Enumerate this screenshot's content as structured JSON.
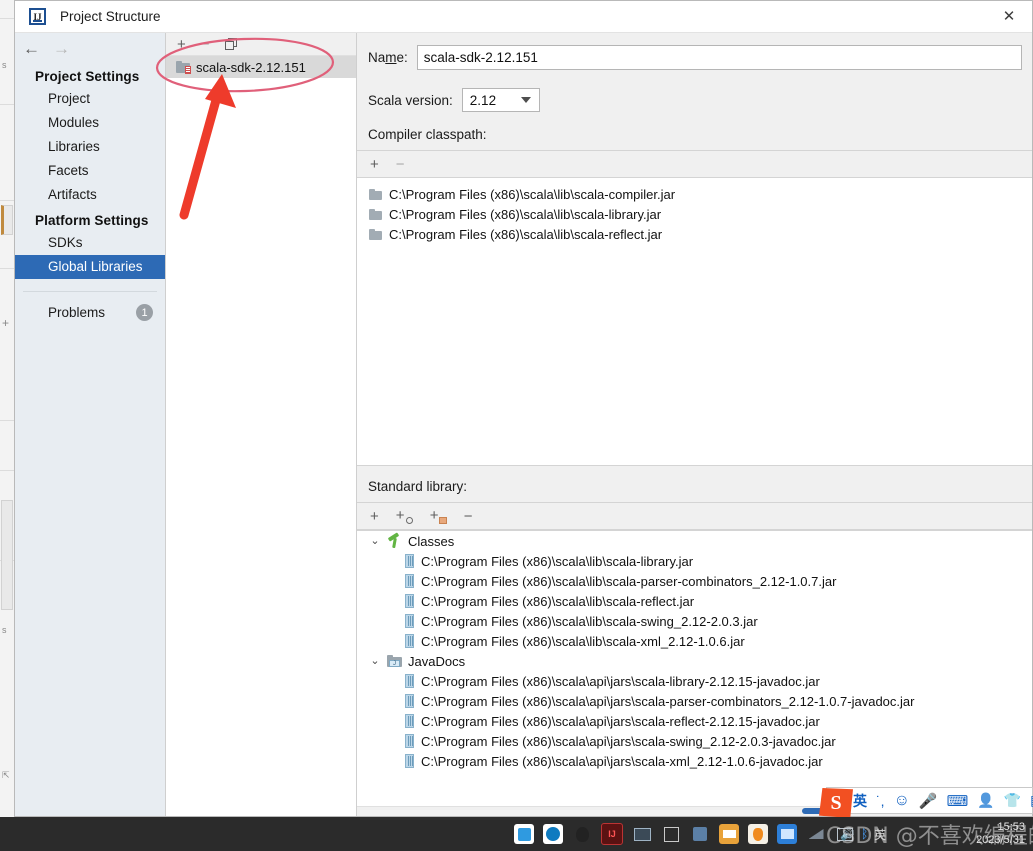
{
  "window": {
    "title": "Project Structure",
    "logo_text": "IJ",
    "close_label": "✕"
  },
  "nav": {
    "back_icon": "←",
    "forward_icon": "→",
    "groups": [
      {
        "label": "Project Settings",
        "items": [
          {
            "label": "Project",
            "selected": false
          },
          {
            "label": "Modules",
            "selected": false
          },
          {
            "label": "Libraries",
            "selected": false
          },
          {
            "label": "Facets",
            "selected": false
          },
          {
            "label": "Artifacts",
            "selected": false
          }
        ]
      },
      {
        "label": "Platform Settings",
        "items": [
          {
            "label": "SDKs",
            "selected": false
          },
          {
            "label": "Global Libraries",
            "selected": true
          }
        ]
      }
    ],
    "problems": {
      "label": "Problems",
      "count": "1"
    }
  },
  "libraries_panel": {
    "toolbar": {
      "add": "+",
      "remove": "−",
      "copy": "copy"
    },
    "items": [
      {
        "label": "scala-sdk-2.12.151",
        "selected": true
      }
    ]
  },
  "detail": {
    "name_label_pre": "Na",
    "name_label_mid": "m",
    "name_label_post": "e:",
    "name_value": "scala-sdk-2.12.151",
    "scala_version_label": "Scala version:",
    "scala_version_value": "2.12",
    "compiler_classpath_label": "Compiler classpath:",
    "classpath_toolbar": {
      "add": "+",
      "remove": "−"
    },
    "compiler_classpath": [
      "C:\\Program Files (x86)\\scala\\lib\\scala-compiler.jar",
      "C:\\Program Files (x86)\\scala\\lib\\scala-library.jar",
      "C:\\Program Files (x86)\\scala\\lib\\scala-reflect.jar"
    ],
    "standard_library_label": "Standard library:",
    "stdlib_toolbar": {
      "add": "+",
      "add_classes": "+",
      "add_sources": "+",
      "remove": "−"
    },
    "tree": [
      {
        "label": "Classes",
        "chevron": "⌄",
        "icon": "hammer-icon",
        "children": [
          "C:\\Program Files (x86)\\scala\\lib\\scala-library.jar",
          "C:\\Program Files (x86)\\scala\\lib\\scala-parser-combinators_2.12-1.0.7.jar",
          "C:\\Program Files (x86)\\scala\\lib\\scala-reflect.jar",
          "C:\\Program Files (x86)\\scala\\lib\\scala-swing_2.12-2.0.3.jar",
          "C:\\Program Files (x86)\\scala\\lib\\scala-xml_2.12-1.0.6.jar"
        ]
      },
      {
        "label": "JavaDocs",
        "chevron": "⌄",
        "icon": "javadoc-folder-icon",
        "children": [
          "C:\\Program Files (x86)\\scala\\api\\jars\\scala-library-2.12.15-javadoc.jar",
          "C:\\Program Files (x86)\\scala\\api\\jars\\scala-parser-combinators_2.12-1.0.7-javadoc.jar",
          "C:\\Program Files (x86)\\scala\\api\\jars\\scala-reflect-2.12.15-javadoc.jar",
          "C:\\Program Files (x86)\\scala\\api\\jars\\scala-swing_2.12-2.0.3-javadoc.jar",
          "C:\\Program Files (x86)\\scala\\api\\jars\\scala-xml_2.12-1.0.6-javadoc.jar"
        ]
      }
    ]
  },
  "ime": {
    "logo": "S",
    "mode": "英",
    "punct": "˙,",
    "emoji": "☺",
    "mic": "mic-icon",
    "keyboard": "keyboard-icon",
    "user": "user-icon",
    "skin": "skin-icon",
    "apps": "apps-icon"
  },
  "taskbar": {
    "icons": [
      "telegram-icon",
      "edge-icon",
      "qq-icon",
      "intellij-icon",
      "remote-desktop-icon",
      "window-copy-icon",
      "security-shield-icon",
      "explorer-window-icon",
      "firewall-flame-icon",
      "monitor-icon",
      "network-off-icon",
      "network-pc-icon"
    ],
    "tray": [
      "volume-icon",
      "bluetooth-icon",
      "ime-lang-icon"
    ],
    "clock_time": "15:53",
    "clock_date": "2023/5/31",
    "watermark": "CSDN @不喜欢编程的我"
  },
  "colors": {
    "accent": "#2d6ab5",
    "nav_bg": "#e8edf2",
    "dialog_bg": "#f0f0f0",
    "annotation_red": "#e8402a",
    "ellipse_red": "#e0607a",
    "taskbar_bg": "#2b2b2b"
  }
}
